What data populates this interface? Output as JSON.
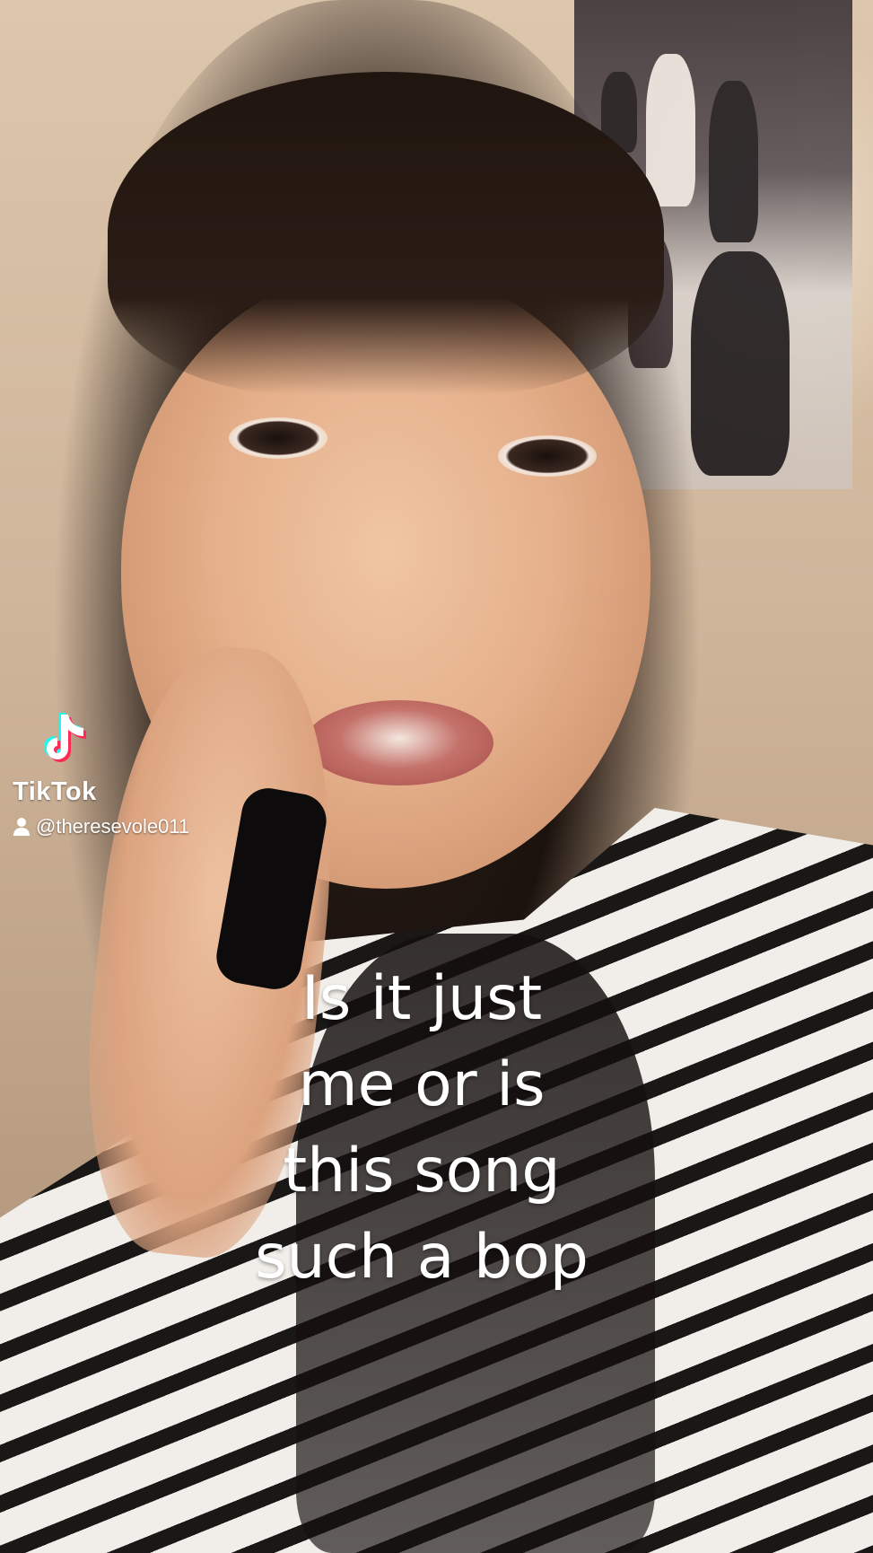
{
  "watermark": {
    "brand": "TikTok",
    "username": "@theresevole011",
    "icons": [
      "tiktok-note-icon",
      "user-icon"
    ],
    "colors": {
      "cyan": "#25f4ee",
      "red": "#fe2c55",
      "white": "#ffffff"
    }
  },
  "caption": {
    "lines": [
      "Is it just",
      "me or is",
      "this song",
      "such a bop"
    ]
  }
}
